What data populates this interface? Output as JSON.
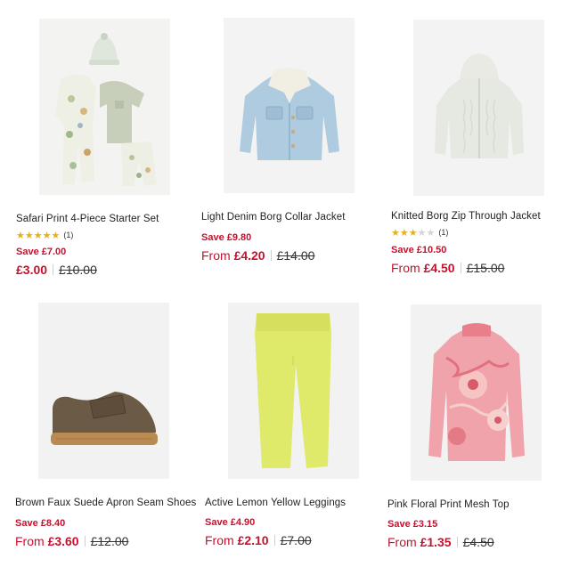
{
  "products": [
    {
      "name": "Safari Print 4-Piece Starter Set",
      "rating_count": "(1)",
      "rating": 5,
      "save": "Save £7.00",
      "from": "",
      "now": "£3.00",
      "was": "£10.00"
    },
    {
      "name": "Light Denim Borg Collar Jacket",
      "save": "Save £9.80",
      "from": "From",
      "now": "£4.20",
      "was": "£14.00"
    },
    {
      "name": "Knitted Borg Zip Through Jacket",
      "rating_count": "(1)",
      "rating": 3,
      "save": "Save £10.50",
      "from": "From",
      "now": "£4.50",
      "was": "£15.00"
    },
    {
      "name": "Brown Faux Suede Apron Seam Shoes",
      "save": "Save £8.40",
      "from": "From",
      "now": "£3.60",
      "was": "£12.00"
    },
    {
      "name": "Active Lemon Yellow Leggings",
      "save": "Save £4.90",
      "from": "From",
      "now": "£2.10",
      "was": "£7.00"
    },
    {
      "name": "Pink Floral Print Mesh Top",
      "save": "Save £3.15",
      "from": "From",
      "now": "£1.35",
      "was": "£4.50"
    }
  ],
  "icons": {
    "star": "star-icon"
  },
  "colors": {
    "sale_red": "#c8102e",
    "star_gold": "#e3b21a",
    "image_bg": "#f2f2f2"
  }
}
